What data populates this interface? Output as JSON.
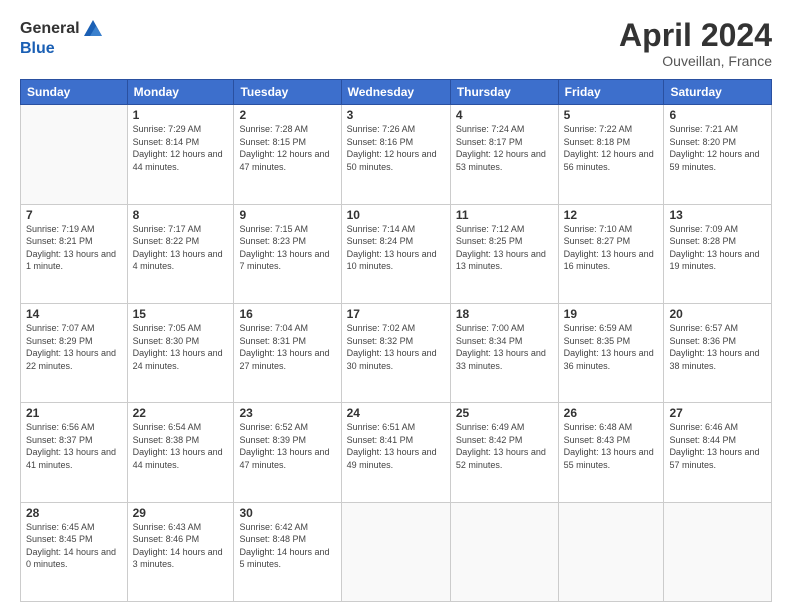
{
  "header": {
    "logo_general": "General",
    "logo_blue": "Blue",
    "month": "April 2024",
    "location": "Ouveillan, France"
  },
  "days_of_week": [
    "Sunday",
    "Monday",
    "Tuesday",
    "Wednesday",
    "Thursday",
    "Friday",
    "Saturday"
  ],
  "weeks": [
    [
      {
        "day": "",
        "sunrise": "",
        "sunset": "",
        "daylight": ""
      },
      {
        "day": "1",
        "sunrise": "Sunrise: 7:29 AM",
        "sunset": "Sunset: 8:14 PM",
        "daylight": "Daylight: 12 hours and 44 minutes."
      },
      {
        "day": "2",
        "sunrise": "Sunrise: 7:28 AM",
        "sunset": "Sunset: 8:15 PM",
        "daylight": "Daylight: 12 hours and 47 minutes."
      },
      {
        "day": "3",
        "sunrise": "Sunrise: 7:26 AM",
        "sunset": "Sunset: 8:16 PM",
        "daylight": "Daylight: 12 hours and 50 minutes."
      },
      {
        "day": "4",
        "sunrise": "Sunrise: 7:24 AM",
        "sunset": "Sunset: 8:17 PM",
        "daylight": "Daylight: 12 hours and 53 minutes."
      },
      {
        "day": "5",
        "sunrise": "Sunrise: 7:22 AM",
        "sunset": "Sunset: 8:18 PM",
        "daylight": "Daylight: 12 hours and 56 minutes."
      },
      {
        "day": "6",
        "sunrise": "Sunrise: 7:21 AM",
        "sunset": "Sunset: 8:20 PM",
        "daylight": "Daylight: 12 hours and 59 minutes."
      }
    ],
    [
      {
        "day": "7",
        "sunrise": "Sunrise: 7:19 AM",
        "sunset": "Sunset: 8:21 PM",
        "daylight": "Daylight: 13 hours and 1 minute."
      },
      {
        "day": "8",
        "sunrise": "Sunrise: 7:17 AM",
        "sunset": "Sunset: 8:22 PM",
        "daylight": "Daylight: 13 hours and 4 minutes."
      },
      {
        "day": "9",
        "sunrise": "Sunrise: 7:15 AM",
        "sunset": "Sunset: 8:23 PM",
        "daylight": "Daylight: 13 hours and 7 minutes."
      },
      {
        "day": "10",
        "sunrise": "Sunrise: 7:14 AM",
        "sunset": "Sunset: 8:24 PM",
        "daylight": "Daylight: 13 hours and 10 minutes."
      },
      {
        "day": "11",
        "sunrise": "Sunrise: 7:12 AM",
        "sunset": "Sunset: 8:25 PM",
        "daylight": "Daylight: 13 hours and 13 minutes."
      },
      {
        "day": "12",
        "sunrise": "Sunrise: 7:10 AM",
        "sunset": "Sunset: 8:27 PM",
        "daylight": "Daylight: 13 hours and 16 minutes."
      },
      {
        "day": "13",
        "sunrise": "Sunrise: 7:09 AM",
        "sunset": "Sunset: 8:28 PM",
        "daylight": "Daylight: 13 hours and 19 minutes."
      }
    ],
    [
      {
        "day": "14",
        "sunrise": "Sunrise: 7:07 AM",
        "sunset": "Sunset: 8:29 PM",
        "daylight": "Daylight: 13 hours and 22 minutes."
      },
      {
        "day": "15",
        "sunrise": "Sunrise: 7:05 AM",
        "sunset": "Sunset: 8:30 PM",
        "daylight": "Daylight: 13 hours and 24 minutes."
      },
      {
        "day": "16",
        "sunrise": "Sunrise: 7:04 AM",
        "sunset": "Sunset: 8:31 PM",
        "daylight": "Daylight: 13 hours and 27 minutes."
      },
      {
        "day": "17",
        "sunrise": "Sunrise: 7:02 AM",
        "sunset": "Sunset: 8:32 PM",
        "daylight": "Daylight: 13 hours and 30 minutes."
      },
      {
        "day": "18",
        "sunrise": "Sunrise: 7:00 AM",
        "sunset": "Sunset: 8:34 PM",
        "daylight": "Daylight: 13 hours and 33 minutes."
      },
      {
        "day": "19",
        "sunrise": "Sunrise: 6:59 AM",
        "sunset": "Sunset: 8:35 PM",
        "daylight": "Daylight: 13 hours and 36 minutes."
      },
      {
        "day": "20",
        "sunrise": "Sunrise: 6:57 AM",
        "sunset": "Sunset: 8:36 PM",
        "daylight": "Daylight: 13 hours and 38 minutes."
      }
    ],
    [
      {
        "day": "21",
        "sunrise": "Sunrise: 6:56 AM",
        "sunset": "Sunset: 8:37 PM",
        "daylight": "Daylight: 13 hours and 41 minutes."
      },
      {
        "day": "22",
        "sunrise": "Sunrise: 6:54 AM",
        "sunset": "Sunset: 8:38 PM",
        "daylight": "Daylight: 13 hours and 44 minutes."
      },
      {
        "day": "23",
        "sunrise": "Sunrise: 6:52 AM",
        "sunset": "Sunset: 8:39 PM",
        "daylight": "Daylight: 13 hours and 47 minutes."
      },
      {
        "day": "24",
        "sunrise": "Sunrise: 6:51 AM",
        "sunset": "Sunset: 8:41 PM",
        "daylight": "Daylight: 13 hours and 49 minutes."
      },
      {
        "day": "25",
        "sunrise": "Sunrise: 6:49 AM",
        "sunset": "Sunset: 8:42 PM",
        "daylight": "Daylight: 13 hours and 52 minutes."
      },
      {
        "day": "26",
        "sunrise": "Sunrise: 6:48 AM",
        "sunset": "Sunset: 8:43 PM",
        "daylight": "Daylight: 13 hours and 55 minutes."
      },
      {
        "day": "27",
        "sunrise": "Sunrise: 6:46 AM",
        "sunset": "Sunset: 8:44 PM",
        "daylight": "Daylight: 13 hours and 57 minutes."
      }
    ],
    [
      {
        "day": "28",
        "sunrise": "Sunrise: 6:45 AM",
        "sunset": "Sunset: 8:45 PM",
        "daylight": "Daylight: 14 hours and 0 minutes."
      },
      {
        "day": "29",
        "sunrise": "Sunrise: 6:43 AM",
        "sunset": "Sunset: 8:46 PM",
        "daylight": "Daylight: 14 hours and 3 minutes."
      },
      {
        "day": "30",
        "sunrise": "Sunrise: 6:42 AM",
        "sunset": "Sunset: 8:48 PM",
        "daylight": "Daylight: 14 hours and 5 minutes."
      },
      {
        "day": "",
        "sunrise": "",
        "sunset": "",
        "daylight": ""
      },
      {
        "day": "",
        "sunrise": "",
        "sunset": "",
        "daylight": ""
      },
      {
        "day": "",
        "sunrise": "",
        "sunset": "",
        "daylight": ""
      },
      {
        "day": "",
        "sunrise": "",
        "sunset": "",
        "daylight": ""
      }
    ]
  ]
}
